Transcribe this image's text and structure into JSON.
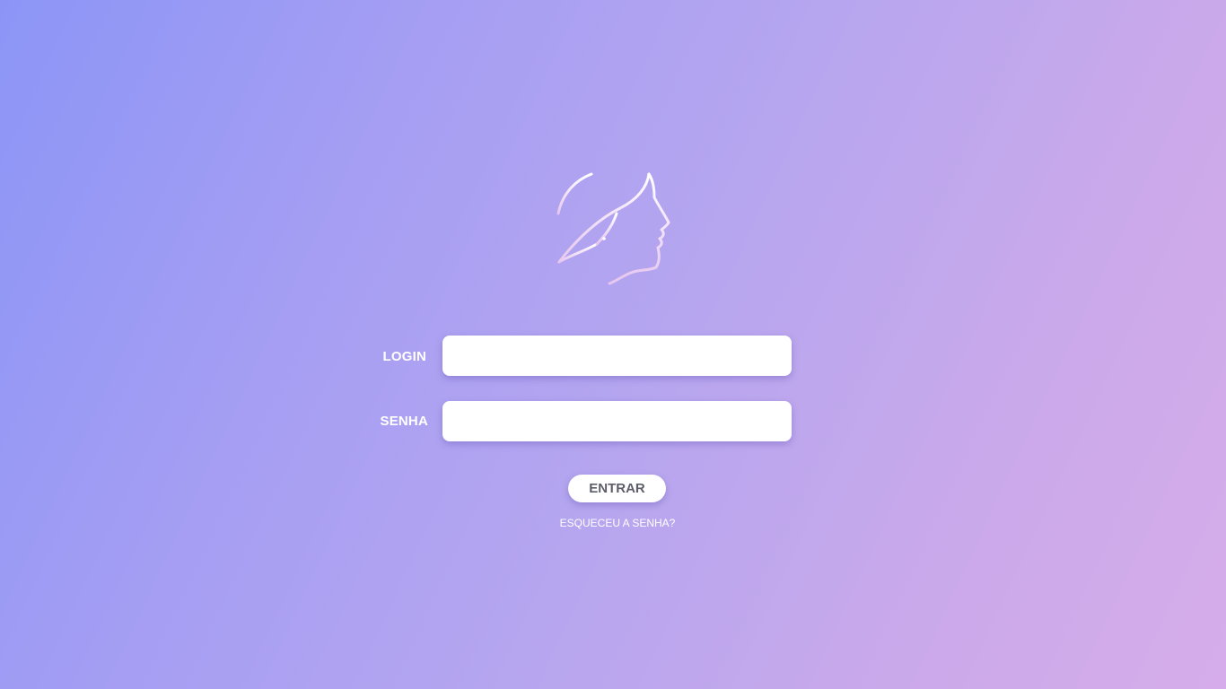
{
  "app": {
    "logo_icon": "woman-profile-leaf-logo-icon"
  },
  "login_form": {
    "login_label": "LOGIN",
    "login_value": "",
    "password_label": "SENHA",
    "password_value": "",
    "submit_label": "ENTRAR",
    "forgot_password_label": "ESQUECEU A SENHA?"
  },
  "colors": {
    "gradient_start": "#8c95f6",
    "gradient_end": "#d6adea",
    "input_background": "#ffffff",
    "button_text": "#5e5e6a",
    "label_text": "#ffffff"
  }
}
